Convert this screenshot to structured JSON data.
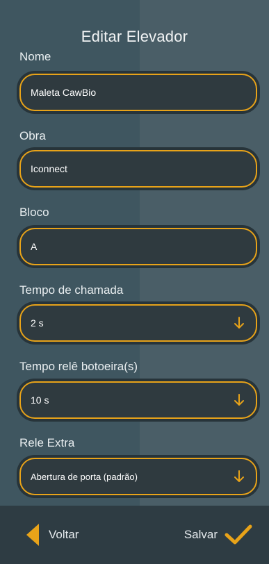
{
  "header": {
    "title": "Editar Elevador"
  },
  "fields": {
    "nome": {
      "label": "Nome",
      "value": "Maleta CawBio"
    },
    "obra": {
      "label": "Obra",
      "value": "Iconnect"
    },
    "bloco": {
      "label": "Bloco",
      "value": "A"
    },
    "tempo_chamada": {
      "label": "Tempo de chamada",
      "value": "2 s"
    },
    "tempo_rele": {
      "label": "Tempo relê botoeira(s)",
      "value": "10 s"
    },
    "rele_extra": {
      "label": "Rele Extra",
      "value": "Abertura de porta (padrão)"
    }
  },
  "footer": {
    "back_label": "Voltar",
    "save_label": "Salvar"
  },
  "colors": {
    "accent": "#e8a319",
    "field_bg": "#2f3a3f",
    "bar_bg": "#2e3c43"
  },
  "icons": {
    "select_arrow": "arrow-down-icon",
    "back": "chevron-left-icon",
    "save": "check-icon"
  }
}
